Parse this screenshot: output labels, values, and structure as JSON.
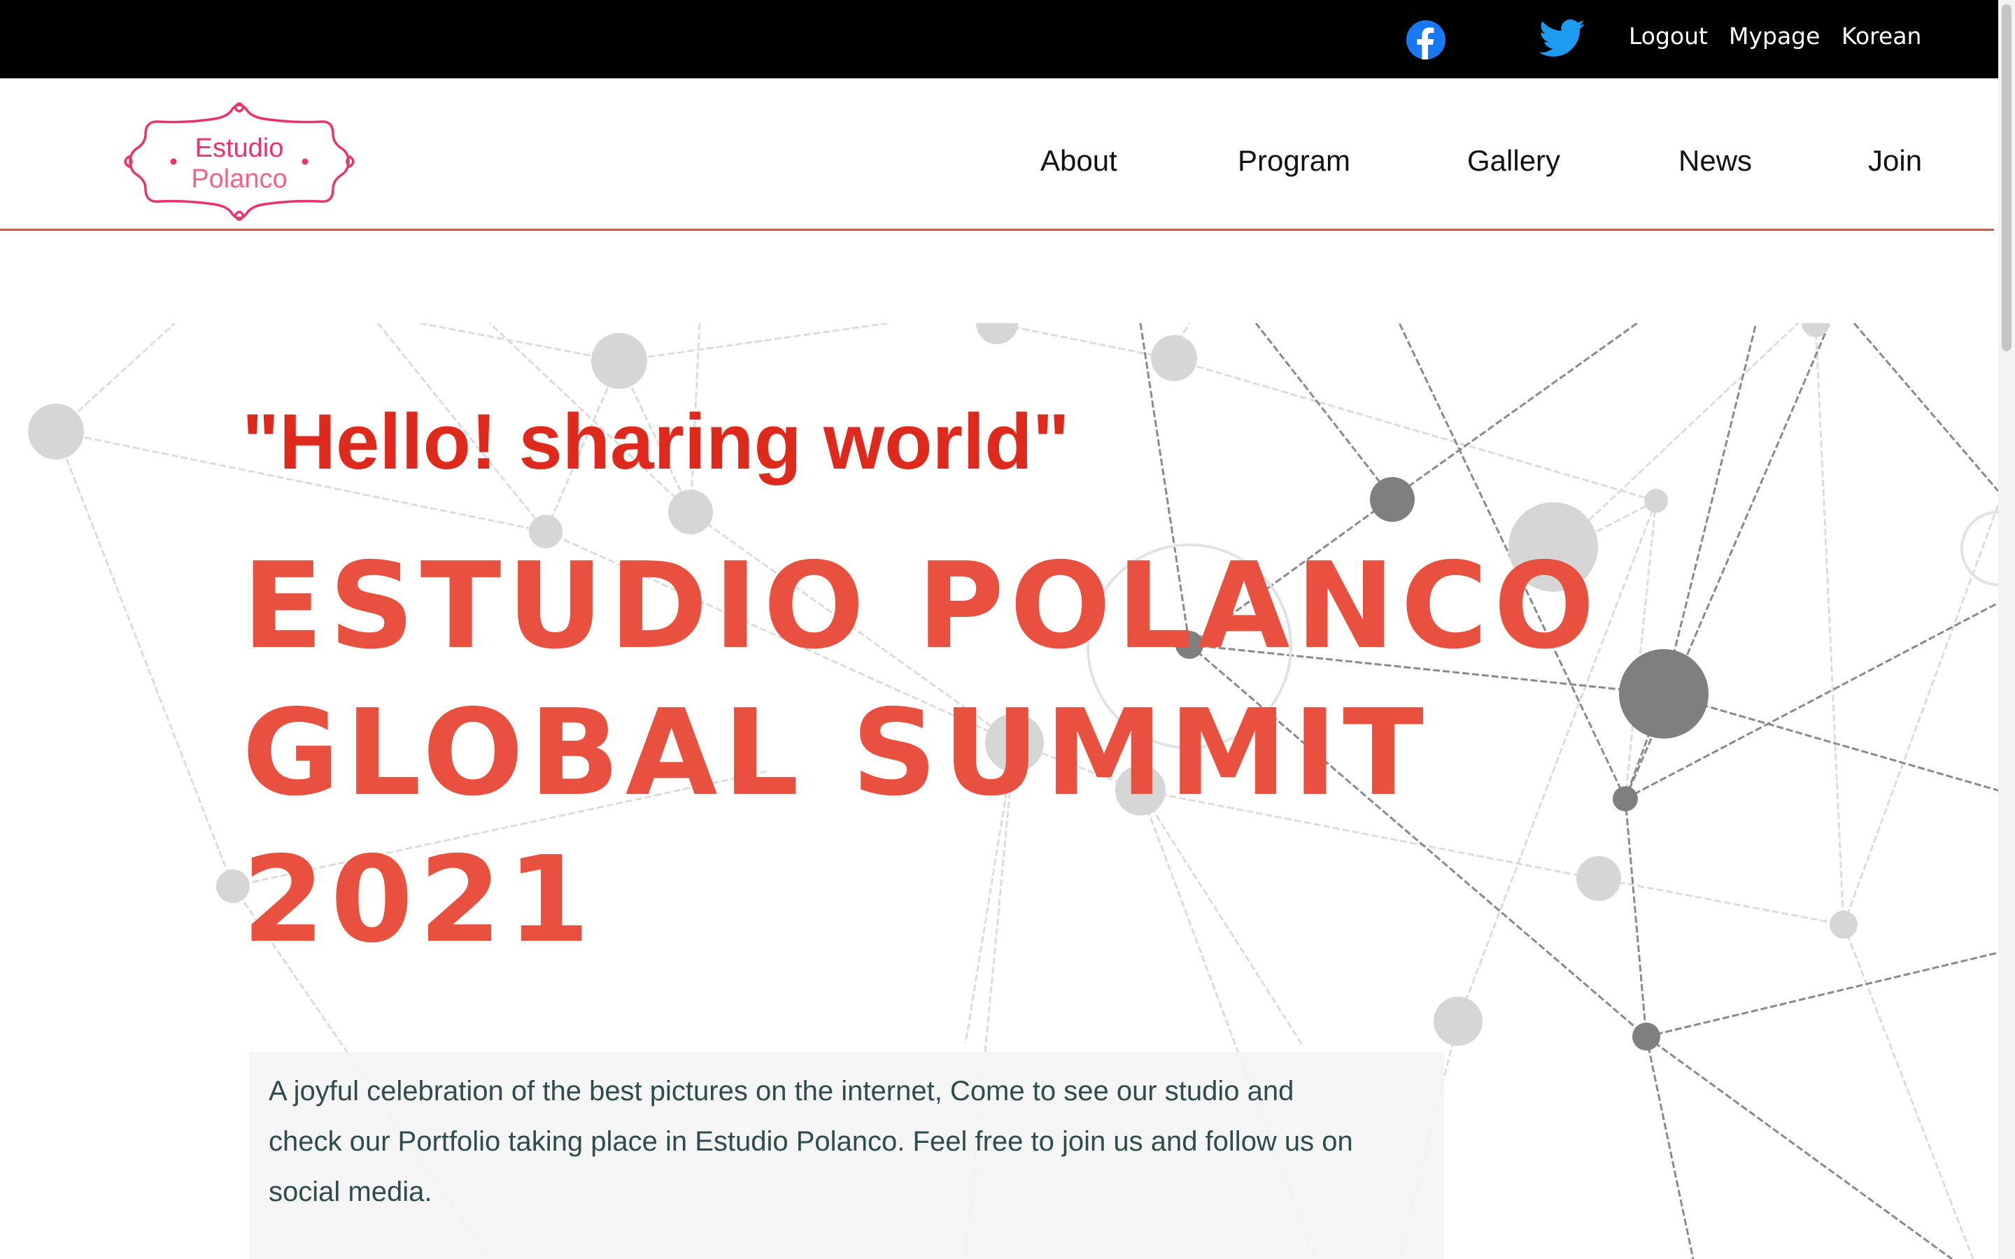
{
  "topbar": {
    "icons": [
      "facebook-icon",
      "twitter-icon"
    ],
    "links": {
      "logout": "Logout",
      "mypage": "Mypage",
      "korean": "Korean"
    }
  },
  "logo": {
    "line1": "Estudio",
    "line2": "Polanco"
  },
  "nav": {
    "about": "About",
    "program": "Program",
    "gallery": "Gallery",
    "news": "News",
    "join": "Join"
  },
  "hero": {
    "tagline": "\"Hello! sharing world\"",
    "title_lines": [
      "ESTUDIO POLANCO",
      "GLOBAL SUMMIT",
      "2021"
    ],
    "description": "A joyful celebration of the best pictures on the internet, Come to see our studio and check our Portfolio taking place in Estudio Polanco. Feel free to join us and follow us on social media."
  },
  "colors": {
    "accent": "#e8503f",
    "tagline": "#dd2a1c",
    "logo_pink": "#e8336b",
    "facebook": "#1877f2",
    "twitter": "#1d9bf0",
    "topbar": "#000000",
    "description_text": "#2f4b4b"
  }
}
